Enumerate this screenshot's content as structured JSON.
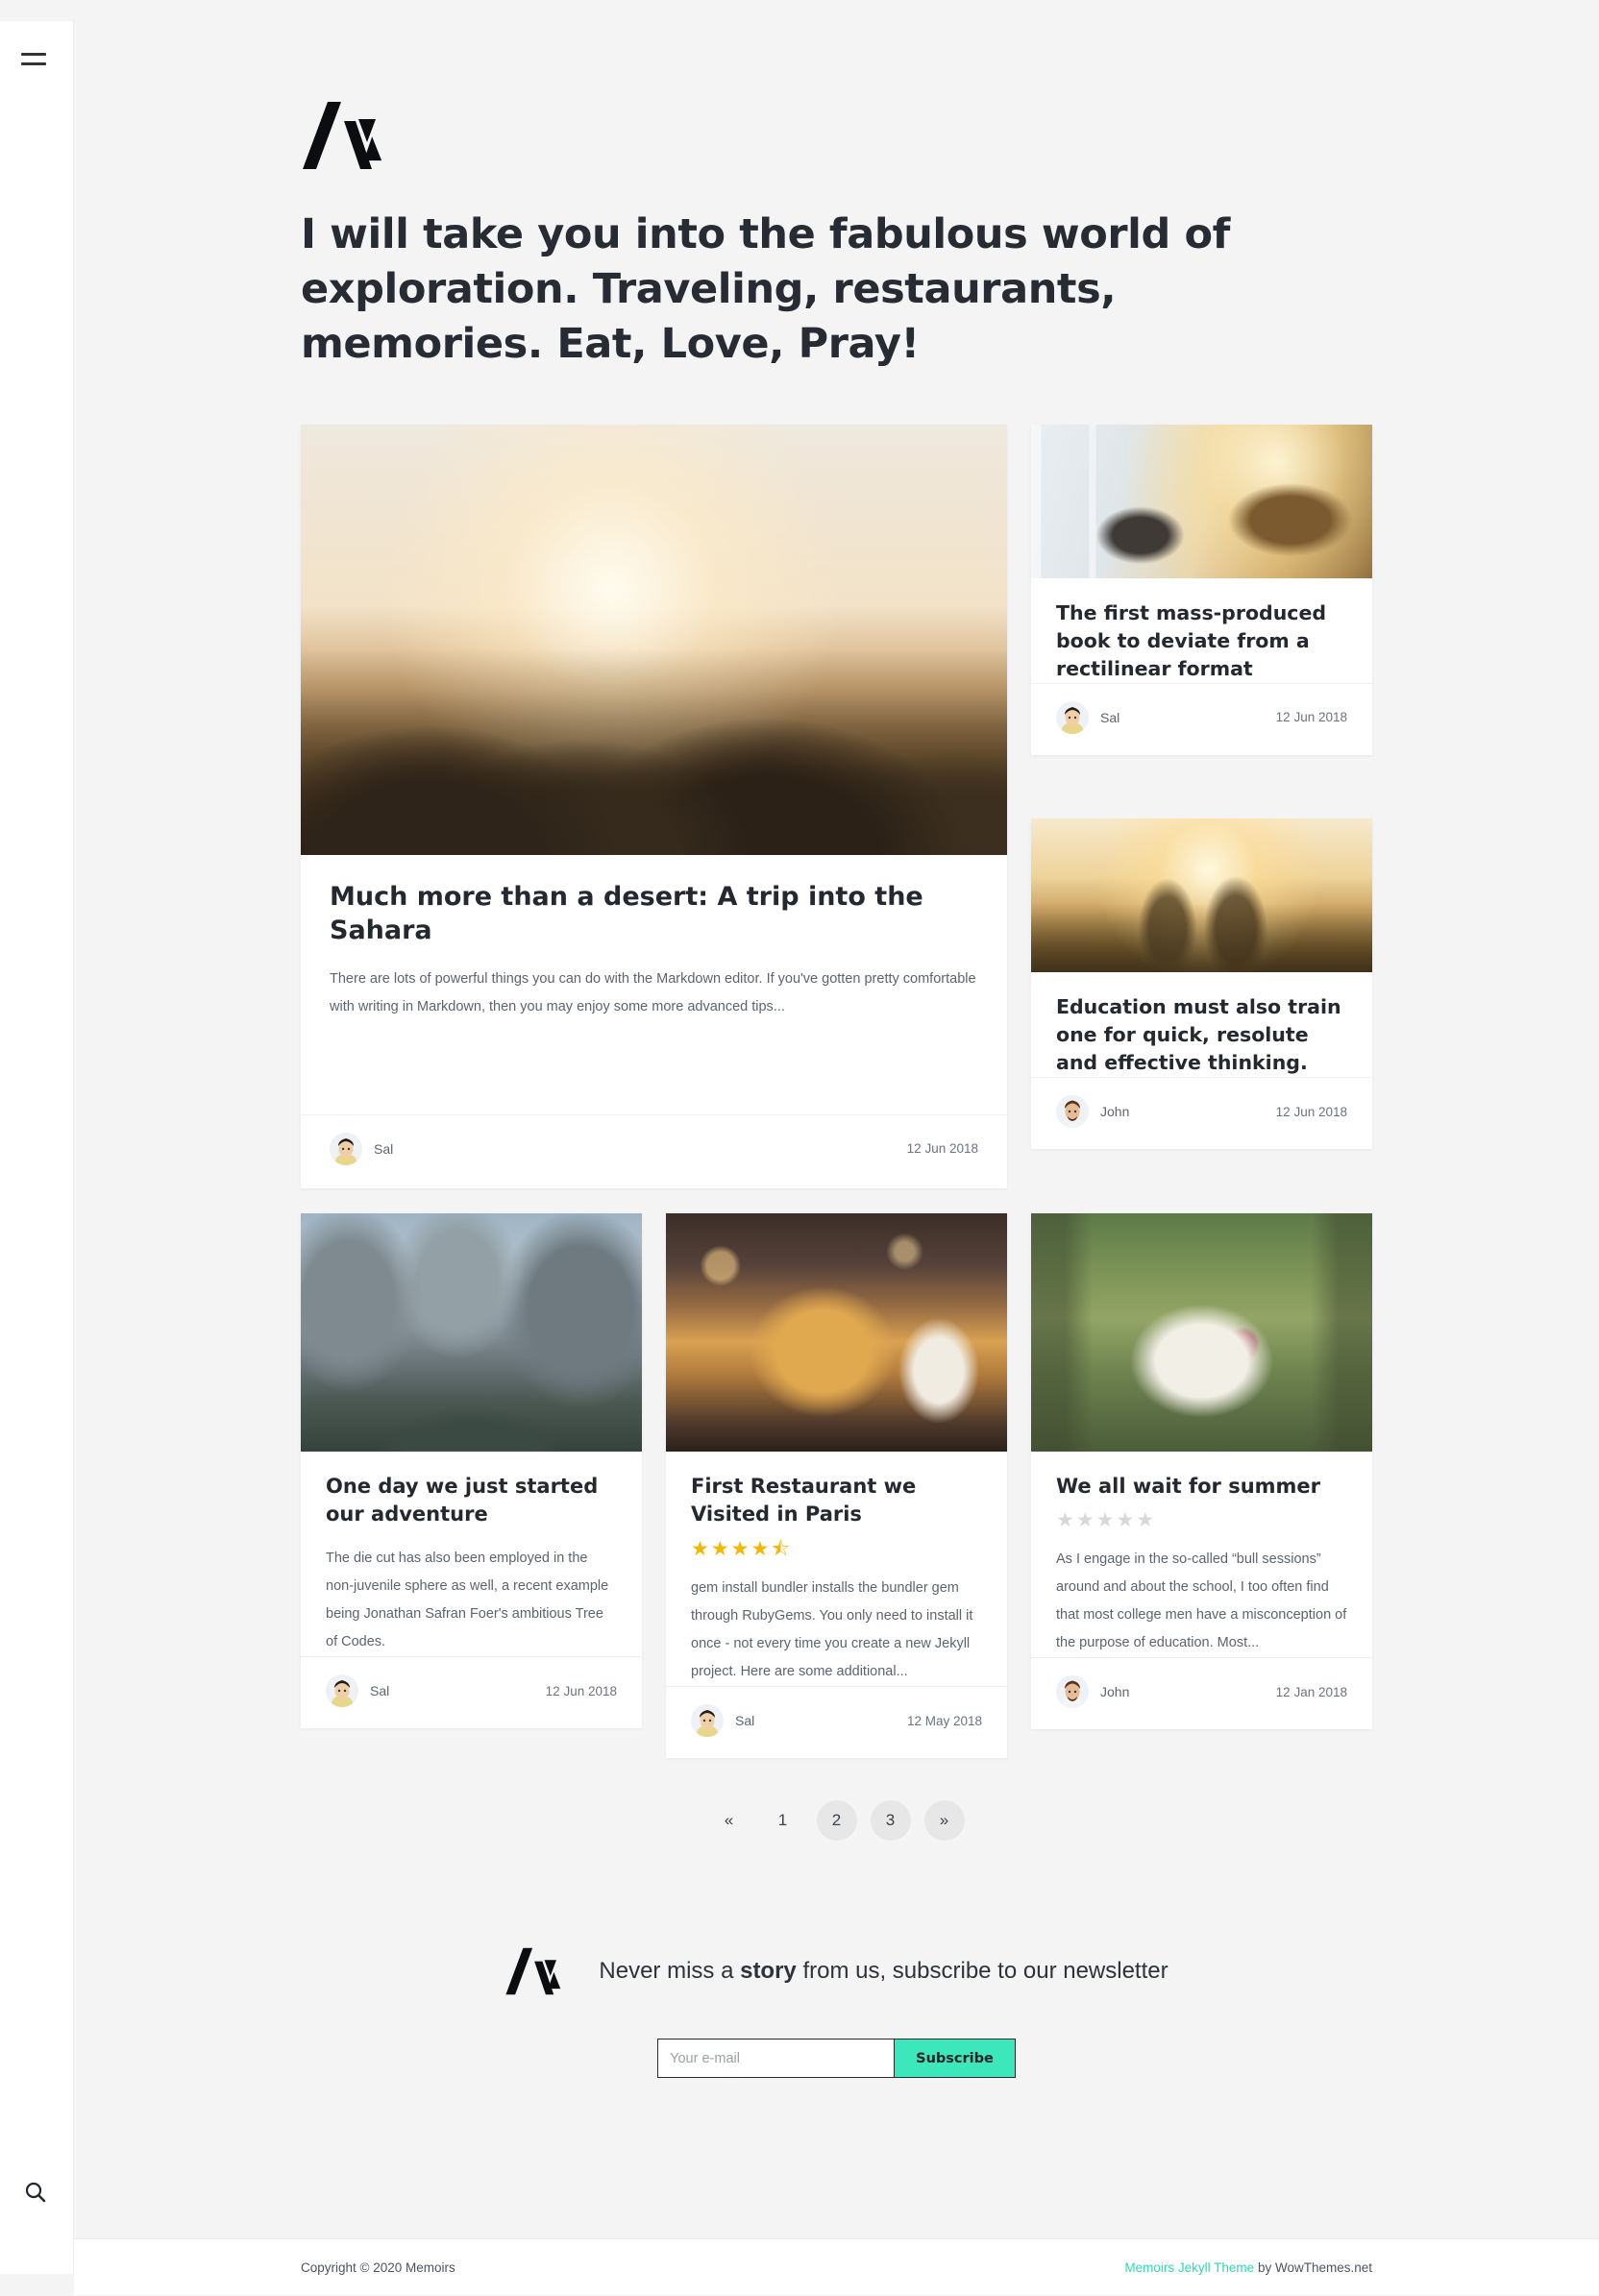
{
  "rail": {
    "menu_icon": "hamburger-icon",
    "search_icon": "search-icon"
  },
  "masthead": {
    "logo_icon": "memoirs-logo",
    "headline": "I will take you into the fabulous world of exploration. Traveling, restaurants, memories. Eat, Love, Pray!"
  },
  "posts": {
    "featured": {
      "image_alt": "friends-watching-sunset-over-mountains",
      "title": "Much more than a desert: A trip into the Sahara",
      "excerpt": "There are lots of powerful things you can do with the Markdown editor. If you've gotten pretty comfortable with writing in Markdown, then you may enjoy some more advanced tips...",
      "author": "Sal",
      "date": "12 Jun 2018"
    },
    "side": [
      {
        "image_alt": "man-waiting-at-airport-with-plane",
        "title": "The first mass-produced book to deviate from a rectilinear format",
        "author": "Sal",
        "date": "12 Jun 2018"
      },
      {
        "image_alt": "two-women-in-sunlit-field",
        "title": "Education must also train one for quick, resolute and effective thinking.",
        "author": "John",
        "date": "12 Jun 2018"
      }
    ],
    "row": [
      {
        "image_alt": "hikers-resting-in-mountains",
        "title": "One day we just started our adventure",
        "excerpt": "The die cut has also been employed in the non-juvenile sphere as well, a recent example being Jonathan Safran Foer's ambitious Tree of Codes.",
        "rating": null,
        "author": "Sal",
        "date": "12 Jun 2018"
      },
      {
        "image_alt": "burger-and-fries-at-restaurant",
        "title": "First Restaurant we Visited in Paris",
        "excerpt": "gem install bundler installs the bundler gem through RubyGems. You only need to install it once - not every time you create a new Jekyll project. Here are some additional...",
        "rating": 4.5,
        "rating_max": 5,
        "author": "Sal",
        "date": "12 May 2018"
      },
      {
        "image_alt": "hand-holding-punnet-of-berries",
        "title": "We all wait for summer",
        "excerpt": "As I engage in the so-called “bull sessions” around and about the school, I too often find that most college men have a misconception of the purpose of education. Most...",
        "rating": 0,
        "rating_max": 5,
        "author": "John",
        "date": "12 Jan 2018"
      }
    ]
  },
  "pagination": {
    "prev": "«",
    "next": "»",
    "pages": [
      "1",
      "2",
      "3"
    ],
    "current": "2"
  },
  "newsletter": {
    "logo_icon": "memoirs-logo",
    "text_before": "Never miss a ",
    "text_strong": "story",
    "text_after": " from us, subscribe to our newsletter",
    "email_placeholder": "Your e-mail",
    "email_value": "",
    "submit_label": "Subscribe",
    "accent_color": "#3ce8bb"
  },
  "footer": {
    "copyright": "Copyright © 2020 Memoirs",
    "credit_link": "Memoirs Jekyll Theme",
    "credit_rest": " by WowThemes.net",
    "link_color": "#2fd9b0"
  }
}
